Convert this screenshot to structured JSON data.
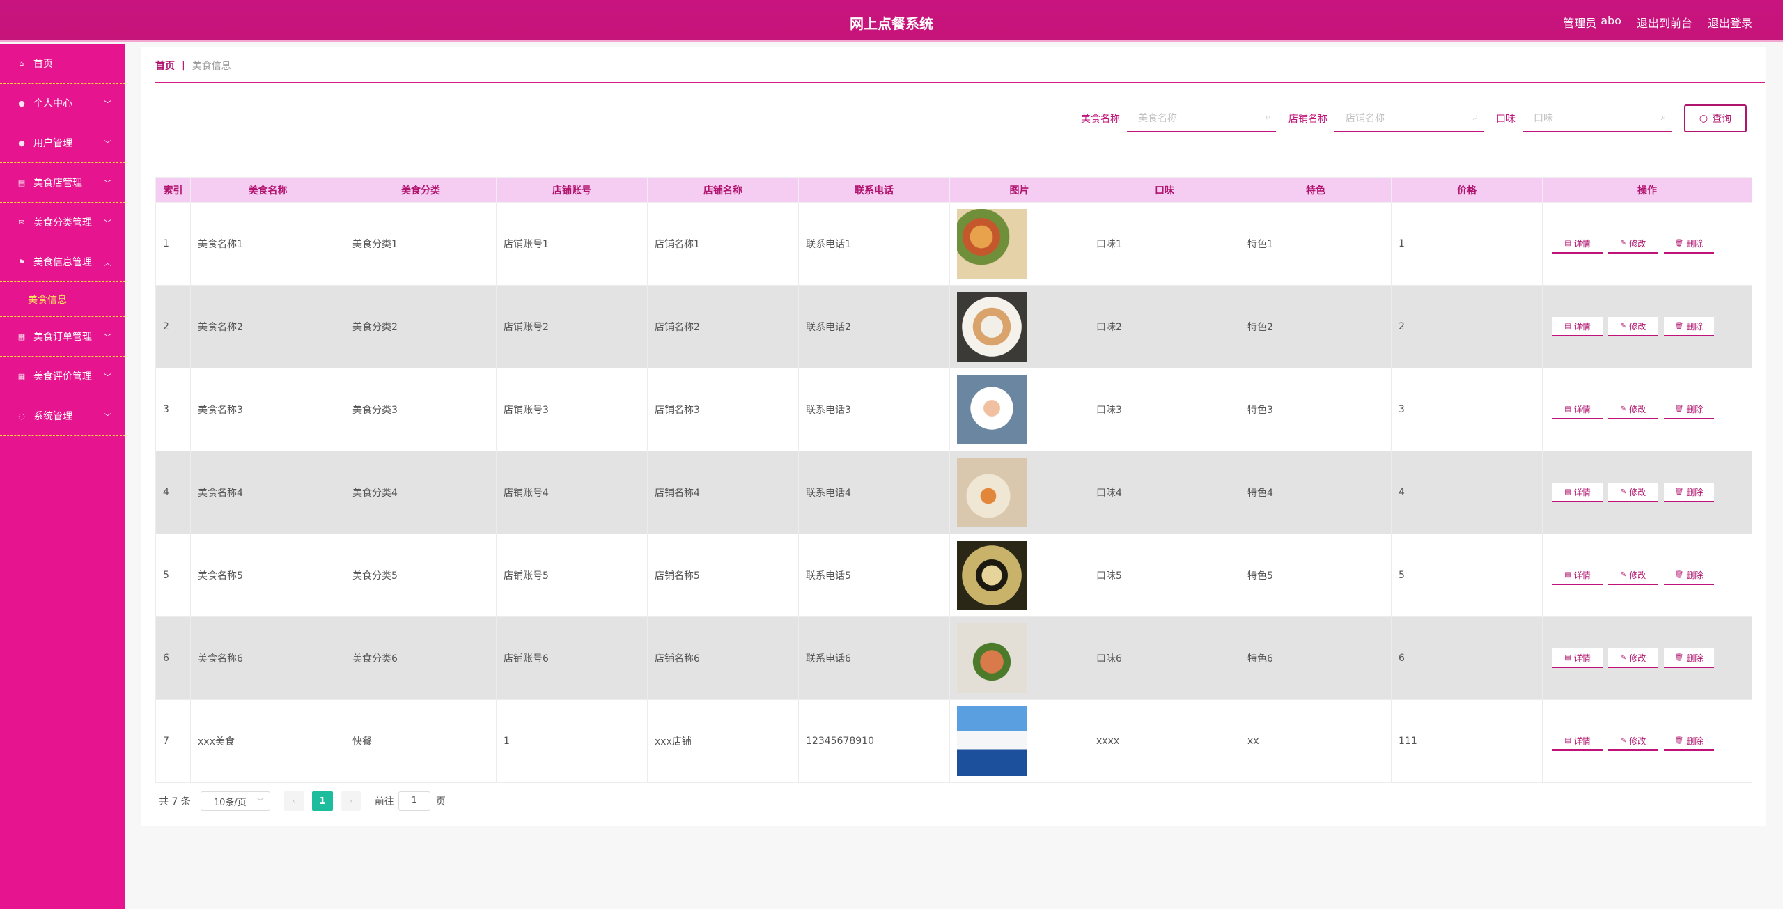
{
  "header": {
    "title": "网上点餐系统",
    "admin_role": "管理员",
    "admin_name": "abo",
    "back_front": "退出到前台",
    "logout": "退出登录"
  },
  "sidebar": {
    "items": [
      {
        "label": "首页",
        "icon": "home-icon"
      },
      {
        "label": "个人中心",
        "icon": "user-icon"
      },
      {
        "label": "用户管理",
        "icon": "user-icon"
      },
      {
        "label": "美食店管理",
        "icon": "shop-icon"
      },
      {
        "label": "美食分类管理",
        "icon": "mail-icon"
      },
      {
        "label": "美食信息管理",
        "icon": "flag-icon"
      },
      {
        "label": "美食信息",
        "icon": ""
      },
      {
        "label": "美食订单管理",
        "icon": "clipboard-icon"
      },
      {
        "label": "美食评价管理",
        "icon": "grid-icon"
      },
      {
        "label": "系统管理",
        "icon": "globe-icon"
      }
    ]
  },
  "breadcrumb": {
    "home": "首页",
    "sep": "|",
    "current": "美食信息"
  },
  "search": {
    "name_label": "美食名称",
    "name_placeholder": "美食名称",
    "shop_label": "店铺名称",
    "shop_placeholder": "店铺名称",
    "taste_label": "口味",
    "taste_placeholder": "口味",
    "query_label": "查询"
  },
  "table": {
    "columns": [
      "索引",
      "美食名称",
      "美食分类",
      "店铺账号",
      "店铺名称",
      "联系电话",
      "图片",
      "口味",
      "特色",
      "价格",
      "操作"
    ],
    "rows": [
      {
        "index": "1",
        "name": "美食名称1",
        "category": "美食分类1",
        "account": "店铺账号1",
        "shop": "店铺名称1",
        "phone": "联系电话1",
        "taste": "口味1",
        "feature": "特色1",
        "price": "1"
      },
      {
        "index": "2",
        "name": "美食名称2",
        "category": "美食分类2",
        "account": "店铺账号2",
        "shop": "店铺名称2",
        "phone": "联系电话2",
        "taste": "口味2",
        "feature": "特色2",
        "price": "2"
      },
      {
        "index": "3",
        "name": "美食名称3",
        "category": "美食分类3",
        "account": "店铺账号3",
        "shop": "店铺名称3",
        "phone": "联系电话3",
        "taste": "口味3",
        "feature": "特色3",
        "price": "3"
      },
      {
        "index": "4",
        "name": "美食名称4",
        "category": "美食分类4",
        "account": "店铺账号4",
        "shop": "店铺名称4",
        "phone": "联系电话4",
        "taste": "口味4",
        "feature": "特色4",
        "price": "4"
      },
      {
        "index": "5",
        "name": "美食名称5",
        "category": "美食分类5",
        "account": "店铺账号5",
        "shop": "店铺名称5",
        "phone": "联系电话5",
        "taste": "口味5",
        "feature": "特色5",
        "price": "5"
      },
      {
        "index": "6",
        "name": "美食名称6",
        "category": "美食分类6",
        "account": "店铺账号6",
        "shop": "店铺名称6",
        "phone": "联系电话6",
        "taste": "口味6",
        "feature": "特色6",
        "price": "6"
      },
      {
        "index": "7",
        "name": "xxx美食",
        "category": "快餐",
        "account": "1",
        "shop": "xxx店铺",
        "phone": "12345678910",
        "taste": "xxxx",
        "feature": "xx",
        "price": "111"
      }
    ],
    "actions": {
      "detail": "详情",
      "edit": "修改",
      "delete": "删除"
    }
  },
  "pagination": {
    "total": "共 7 条",
    "page_size": "10条/页",
    "current_page": "1",
    "goto": "前往",
    "goto_value": "1",
    "page_suffix": "页"
  },
  "colors": {
    "brand": "#c9147f",
    "sidebar": "#e6158f",
    "header_row": "#f6cdf2",
    "accent_text": "#b0146e",
    "active_page": "#1dbc9c"
  }
}
